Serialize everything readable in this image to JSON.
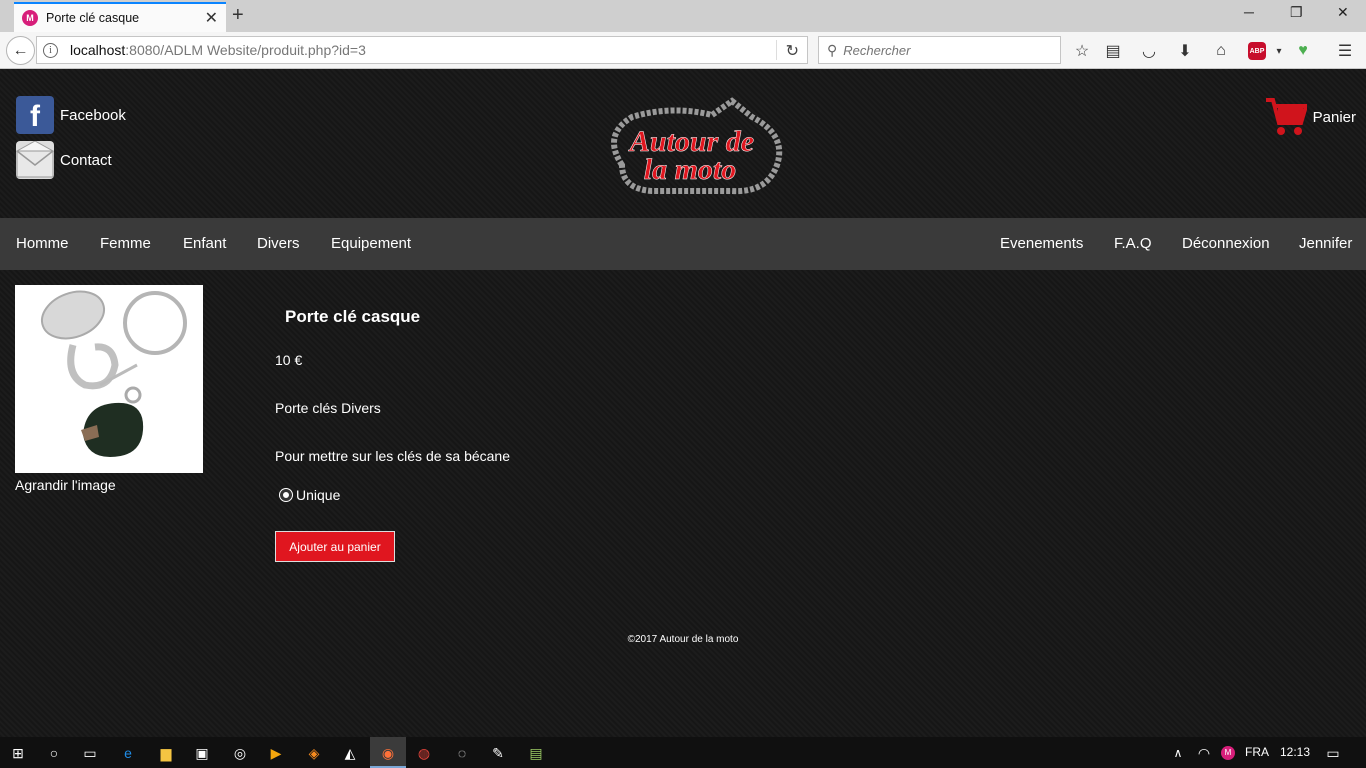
{
  "browser": {
    "tab_title": "Porte clé casque",
    "url_host": "localhost",
    "url_rest": ":8080/ADLM Website/produit.php?id=3",
    "search_placeholder": "Rechercher",
    "abp_label": "ABP"
  },
  "header": {
    "facebook_label": "Facebook",
    "contact_label": "Contact",
    "logo_line1": "Autour de",
    "logo_line2": "la moto",
    "cart_label": "Panier"
  },
  "menu": {
    "left": [
      "Homme",
      "Femme",
      "Enfant",
      "Divers",
      "Equipement"
    ],
    "right": [
      "Evenements",
      "F.A.Q",
      "Déconnexion",
      "Jennifer"
    ]
  },
  "product": {
    "enlarge_label": "Agrandir l'image",
    "name": "Porte clé casque",
    "price": "10 €",
    "category": "Porte clés Divers",
    "description": "Pour mettre sur les clés de sa bécane",
    "option_label": "Unique",
    "add_button": "Ajouter au panier"
  },
  "footer": {
    "text": "©2017 Autour de la moto"
  },
  "taskbar": {
    "language": "FRA",
    "time": "12:13"
  },
  "colors": {
    "accent_red": "#e0161f",
    "menu_bg": "#3a3a3a",
    "page_bg": "#1a1a1a",
    "firefox_tab": "#0a84ff"
  }
}
